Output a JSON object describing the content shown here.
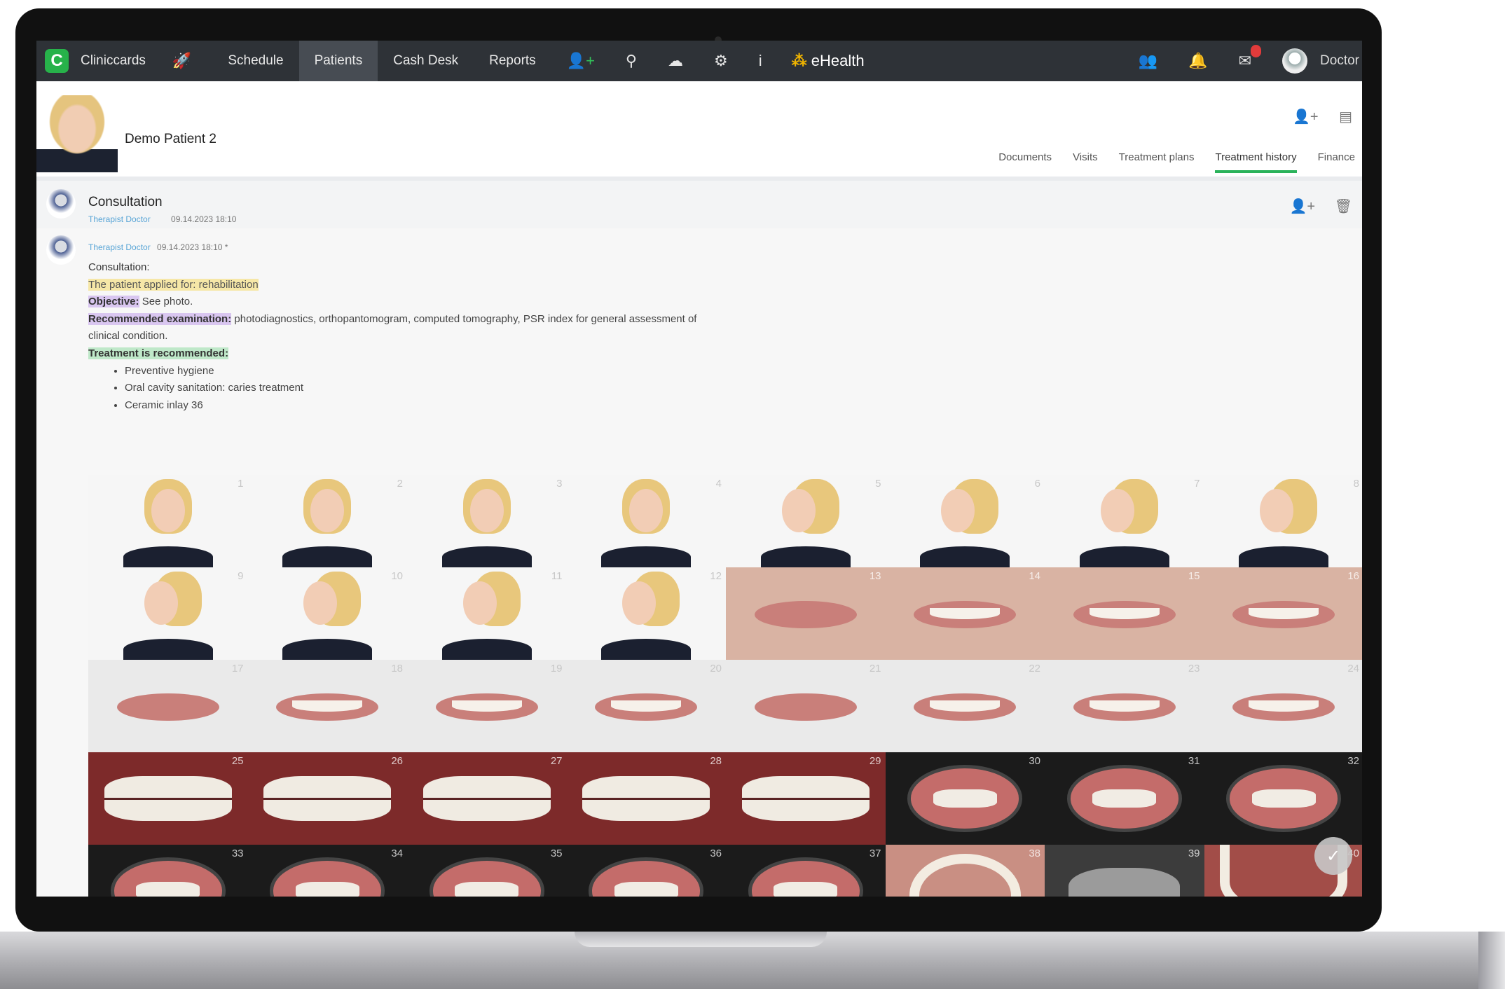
{
  "nav": {
    "logo_letter": "C",
    "brand": "Cliniccards",
    "items": [
      {
        "label": "Schedule",
        "active": false
      },
      {
        "label": "Patients",
        "active": true
      },
      {
        "label": "Cash Desk",
        "active": false
      },
      {
        "label": "Reports",
        "active": false
      }
    ],
    "ehealth": "eHealth",
    "user": "Doctor",
    "icons": [
      "rocket-icon",
      "add-patient-icon",
      "search-icon",
      "cloud-icon",
      "settings-icon",
      "info-icon",
      "users-icon",
      "bell-icon",
      "messages-icon"
    ],
    "accent": "#2bb35b"
  },
  "patient": {
    "name": "Demo Patient 2",
    "tabs": [
      "Documents",
      "Visits",
      "Treatment plans",
      "Treatment history",
      "Finance"
    ],
    "active_tab": "Treatment history"
  },
  "consultation": {
    "title": "Consultation",
    "author": "Therapist Doctor",
    "datetime": "09.14.2023 18:10"
  },
  "note": {
    "author": "Therapist Doctor",
    "datetime": "09.14.2023 18:10 *",
    "heading": "Consultation:",
    "applied": "The patient applied for: rehabilitation",
    "objective_label": "Objective:",
    "objective_text": " See photo.",
    "exam_label": "Recommended examination:",
    "exam_text": " photodiagnostics, orthopantomogram, computed tomography, PSR index for general assessment of clinical condition.",
    "treatment_label": "Treatment is recommended:",
    "treatments": [
      "Preventive hygiene",
      "Oral cavity sanitation: caries treatment",
      "Ceramic inlay 36"
    ]
  },
  "photos": [
    {
      "n": "1",
      "kind": "portrait"
    },
    {
      "n": "2",
      "kind": "portrait"
    },
    {
      "n": "3",
      "kind": "portrait"
    },
    {
      "n": "4",
      "kind": "portrait"
    },
    {
      "n": "5",
      "kind": "portrait side"
    },
    {
      "n": "6",
      "kind": "portrait side"
    },
    {
      "n": "7",
      "kind": "portrait side"
    },
    {
      "n": "8",
      "kind": "portrait side"
    },
    {
      "n": "9",
      "kind": "portrait side"
    },
    {
      "n": "10",
      "kind": "portrait side"
    },
    {
      "n": "11",
      "kind": "portrait side"
    },
    {
      "n": "12",
      "kind": "portrait side"
    },
    {
      "n": "13",
      "kind": "lips"
    },
    {
      "n": "14",
      "kind": "lips smile"
    },
    {
      "n": "15",
      "kind": "lips smile"
    },
    {
      "n": "16",
      "kind": "lips smile"
    },
    {
      "n": "17",
      "kind": "lips side"
    },
    {
      "n": "18",
      "kind": "lips side smile"
    },
    {
      "n": "19",
      "kind": "lips side smile"
    },
    {
      "n": "20",
      "kind": "lips side smile"
    },
    {
      "n": "21",
      "kind": "lips side"
    },
    {
      "n": "22",
      "kind": "lips side smile"
    },
    {
      "n": "23",
      "kind": "lips side smile"
    },
    {
      "n": "24",
      "kind": "lips side smile"
    },
    {
      "n": "25",
      "kind": "teeth"
    },
    {
      "n": "26",
      "kind": "teeth"
    },
    {
      "n": "27",
      "kind": "teeth"
    },
    {
      "n": "28",
      "kind": "teeth"
    },
    {
      "n": "29",
      "kind": "teeth"
    },
    {
      "n": "30",
      "kind": "retract"
    },
    {
      "n": "31",
      "kind": "retract"
    },
    {
      "n": "32",
      "kind": "retract"
    },
    {
      "n": "33",
      "kind": "retract"
    },
    {
      "n": "34",
      "kind": "retract"
    },
    {
      "n": "35",
      "kind": "retract"
    },
    {
      "n": "36",
      "kind": "retract"
    },
    {
      "n": "37",
      "kind": "retract"
    },
    {
      "n": "38",
      "kind": "palate"
    },
    {
      "n": "39",
      "kind": "xray"
    },
    {
      "n": "40",
      "kind": "jaw"
    }
  ]
}
